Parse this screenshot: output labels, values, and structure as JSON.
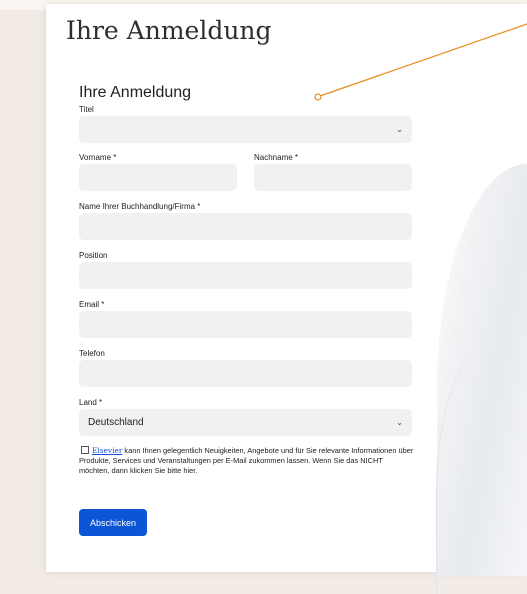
{
  "page": {
    "title": "Ihre Anmeldung",
    "accent_color": "#e88b1f",
    "button_color": "#0a56d6"
  },
  "form": {
    "heading": "Ihre Anmeldung",
    "titel": {
      "label": "Titel",
      "value": ""
    },
    "vorname": {
      "label": "Vorname *",
      "value": ""
    },
    "nachname": {
      "label": "Nachname *",
      "value": ""
    },
    "firma": {
      "label": "Name Ihrer Buchhandlung/Firma *",
      "value": ""
    },
    "position": {
      "label": "Position",
      "value": ""
    },
    "email": {
      "label": "Email *",
      "value": ""
    },
    "telefon": {
      "label": "Telefon",
      "value": ""
    },
    "land": {
      "label": "Land *",
      "value": "Deutschland"
    },
    "consent": {
      "link_text": "Elsevier",
      "text": " kann Ihnen gelegentlich Neuigkeiten, Angebote und für Sie relevante Informationen über Produkte, Services und Veranstaltungen per E-Mail zukommen lassen. Wenn Sie das NICHT möchten, dann klicken Sie bitte hier."
    },
    "submit_label": "Abschicken"
  },
  "icons": {
    "select_chevron": "chevron-down-icon",
    "annotation": "annotation-pointer"
  }
}
